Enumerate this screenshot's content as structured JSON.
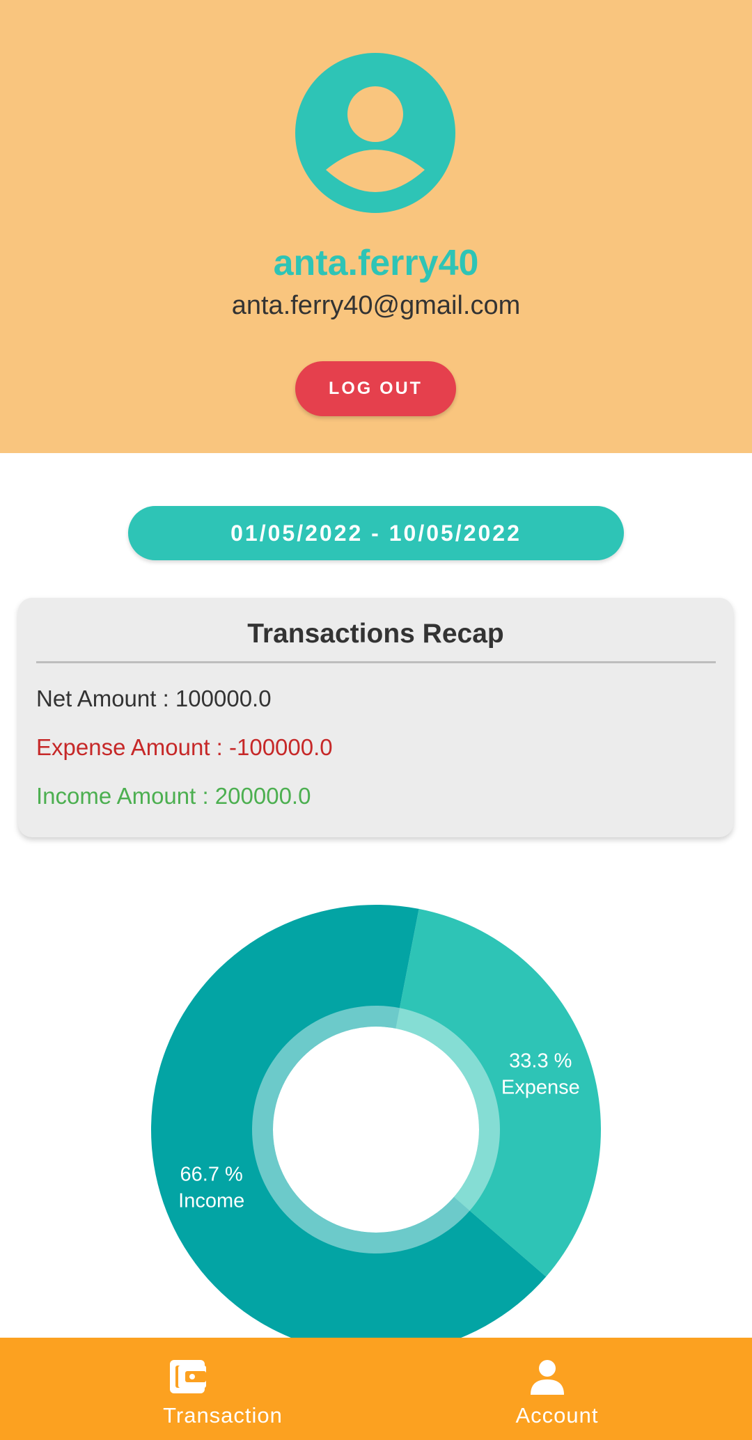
{
  "profile": {
    "username": "anta.ferry40",
    "email": "anta.ferry40@gmail.com",
    "avatar_icon": "user-avatar-icon",
    "logout_label": "LOG OUT"
  },
  "date_range": "01/05/2022 - 10/05/2022",
  "recap": {
    "title": "Transactions Recap",
    "net_label": "Net Amount : 100000.0",
    "expense_label": "Expense Amount : -100000.0",
    "income_label": "Income Amount : 200000.0"
  },
  "colors": {
    "header_bg": "#F9C57E",
    "accent_teal": "#2EC4B6",
    "logout_red": "#E5404D",
    "expense_red": "#C62828",
    "income_green": "#4CAF50",
    "nav_orange": "#FCA120",
    "income_slice": "#03A4A4",
    "expense_slice": "#2EC4B6"
  },
  "chart_data": {
    "type": "pie",
    "slices": [
      {
        "label": "Income",
        "percent_label": "66.7 %",
        "value": 66.7,
        "color": "#03A4A4"
      },
      {
        "label": "Expense",
        "percent_label": "33.3 %",
        "value": 33.3,
        "color": "#2EC4B6"
      }
    ]
  },
  "bottom_nav": {
    "items": [
      {
        "label": "Transaction",
        "icon": "wallet-icon"
      },
      {
        "label": "Account",
        "icon": "person-icon"
      }
    ]
  }
}
